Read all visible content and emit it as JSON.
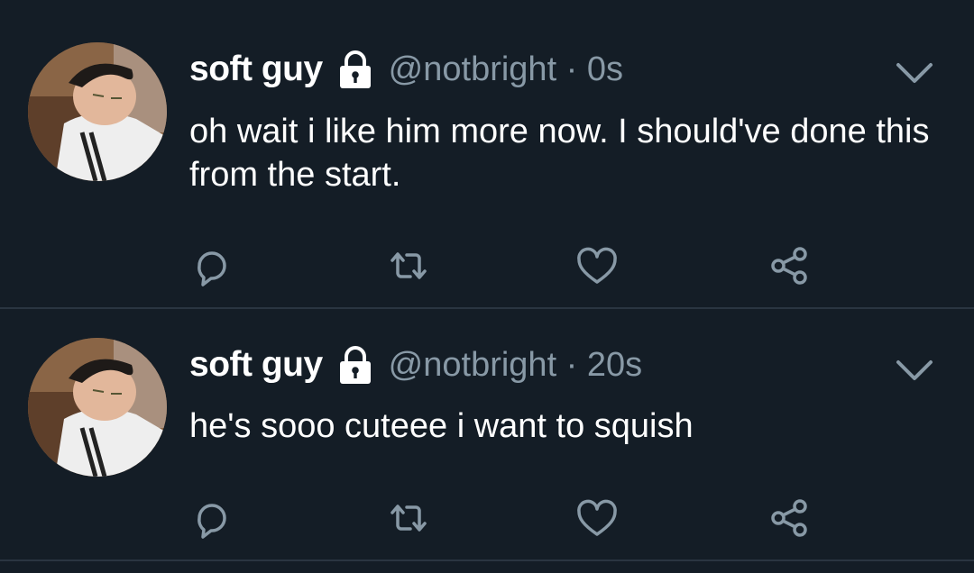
{
  "tweets": [
    {
      "name": "soft guy",
      "handle": "@notbright",
      "time": "0s",
      "meta": "@notbright · 0s",
      "text": "oh wait i like him more now. I should've done this from the start.",
      "protected": true
    },
    {
      "name": "soft guy",
      "handle": "@notbright",
      "time": "20s",
      "meta": "@notbright · 20s",
      "text": "he's sooo cuteee i want to squish",
      "protected": true
    }
  ],
  "icons": {
    "lock": "lock-icon",
    "menu": "chevron-down-icon",
    "reply": "reply-icon",
    "retweet": "retweet-icon",
    "like": "heart-icon",
    "share": "share-icon"
  },
  "colors": {
    "background": "#141d26",
    "divider": "#2a3541",
    "name": "#ffffff",
    "secondary": "#8899a6",
    "text": "#ffffff"
  }
}
